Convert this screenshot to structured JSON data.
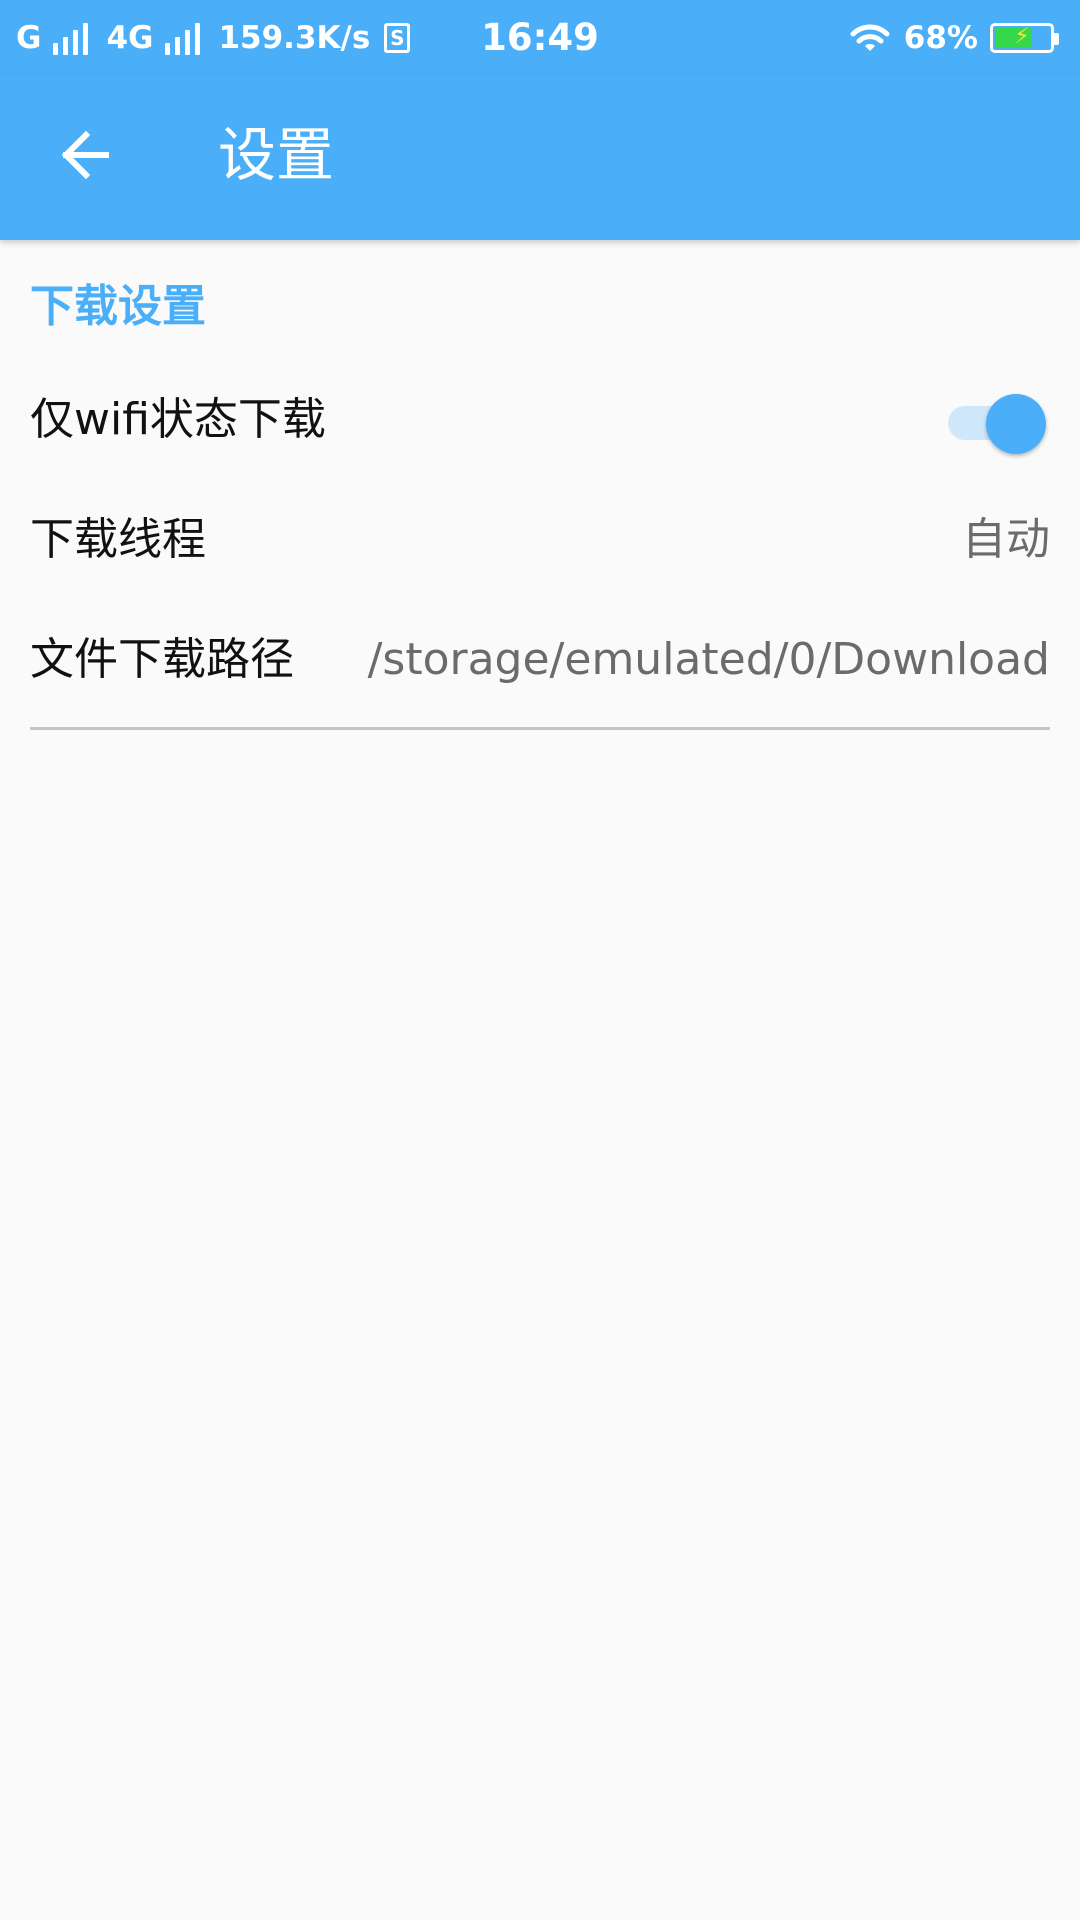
{
  "status_bar": {
    "carrier1": "G",
    "carrier2": "4G",
    "net_speed": "159.3K/s",
    "sim_icon_label": "S",
    "time": "16:49",
    "battery_percent": "68%",
    "battery_level": 0.68,
    "icons": [
      "signal-icon",
      "sim-icon",
      "wifi-icon",
      "battery-icon"
    ]
  },
  "app_bar": {
    "title": "设置",
    "back_icon": "arrow-left-icon"
  },
  "settings": {
    "section_title": "下载设置",
    "items": [
      {
        "label": "仅wifi状态下载",
        "type": "toggle",
        "value": true
      },
      {
        "label": "下载线程",
        "type": "value",
        "value": "自动"
      },
      {
        "label": "文件下载路径",
        "type": "value",
        "value": "/storage/emulated/0/Download"
      }
    ]
  },
  "colors": {
    "primary": "#4aaff8",
    "toggle_track": "#cfe7fb",
    "background": "#fafafa",
    "secondary_text": "#6b6b6b",
    "divider": "#c4c4c4"
  }
}
